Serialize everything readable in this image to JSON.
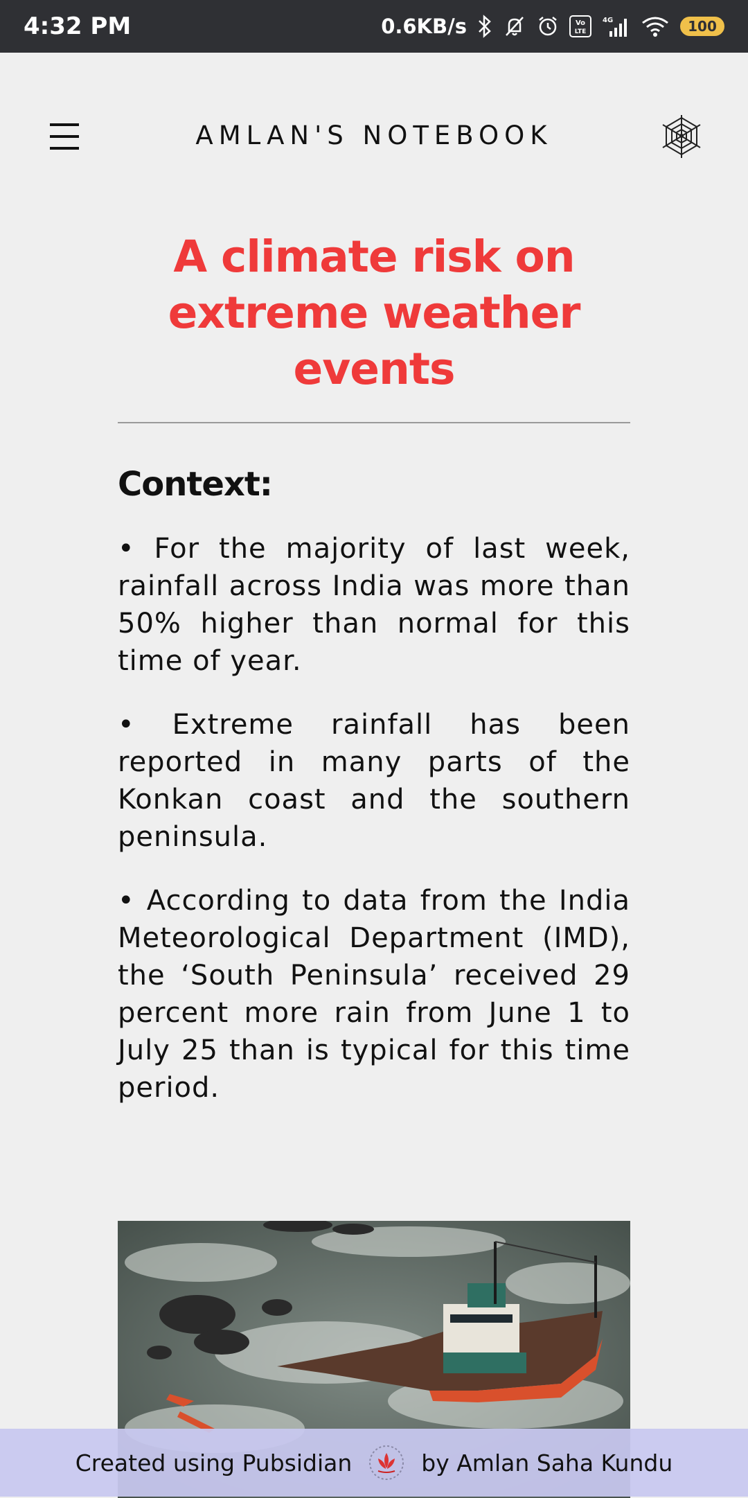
{
  "status": {
    "time": "4:32 PM",
    "speed": "0.6KB/s",
    "network": "4G",
    "volte": "Vo LTE",
    "battery": "100"
  },
  "header": {
    "site_title": "AMLAN'S NOTEBOOK",
    "menu_icon": "hamburger-menu-icon",
    "right_icon": "spider-web-icon"
  },
  "article": {
    "title": "A climate risk on extreme weather events",
    "section_heading": "Context:",
    "paragraphs": [
      "• For the majority of last week, rainfall across India was more than 50% higher than normal for this time of year.",
      "• Extreme rainfall has been reported in many parts of the Konkan coast and the southern peninsula.",
      "• According to data from the India Meteorological Department (IMD), the ‘South Peninsula’ received 29 percent more rain from June 1 to July 25 than is typical for this time period."
    ]
  },
  "footer": {
    "left_text": "Created using Pubsidian",
    "right_text": "by Amlan Saha Kundu"
  },
  "colors": {
    "title_red": "#ef3a3a",
    "status_bar": "#2f3034",
    "footer_bg": "#c8c8f0"
  }
}
